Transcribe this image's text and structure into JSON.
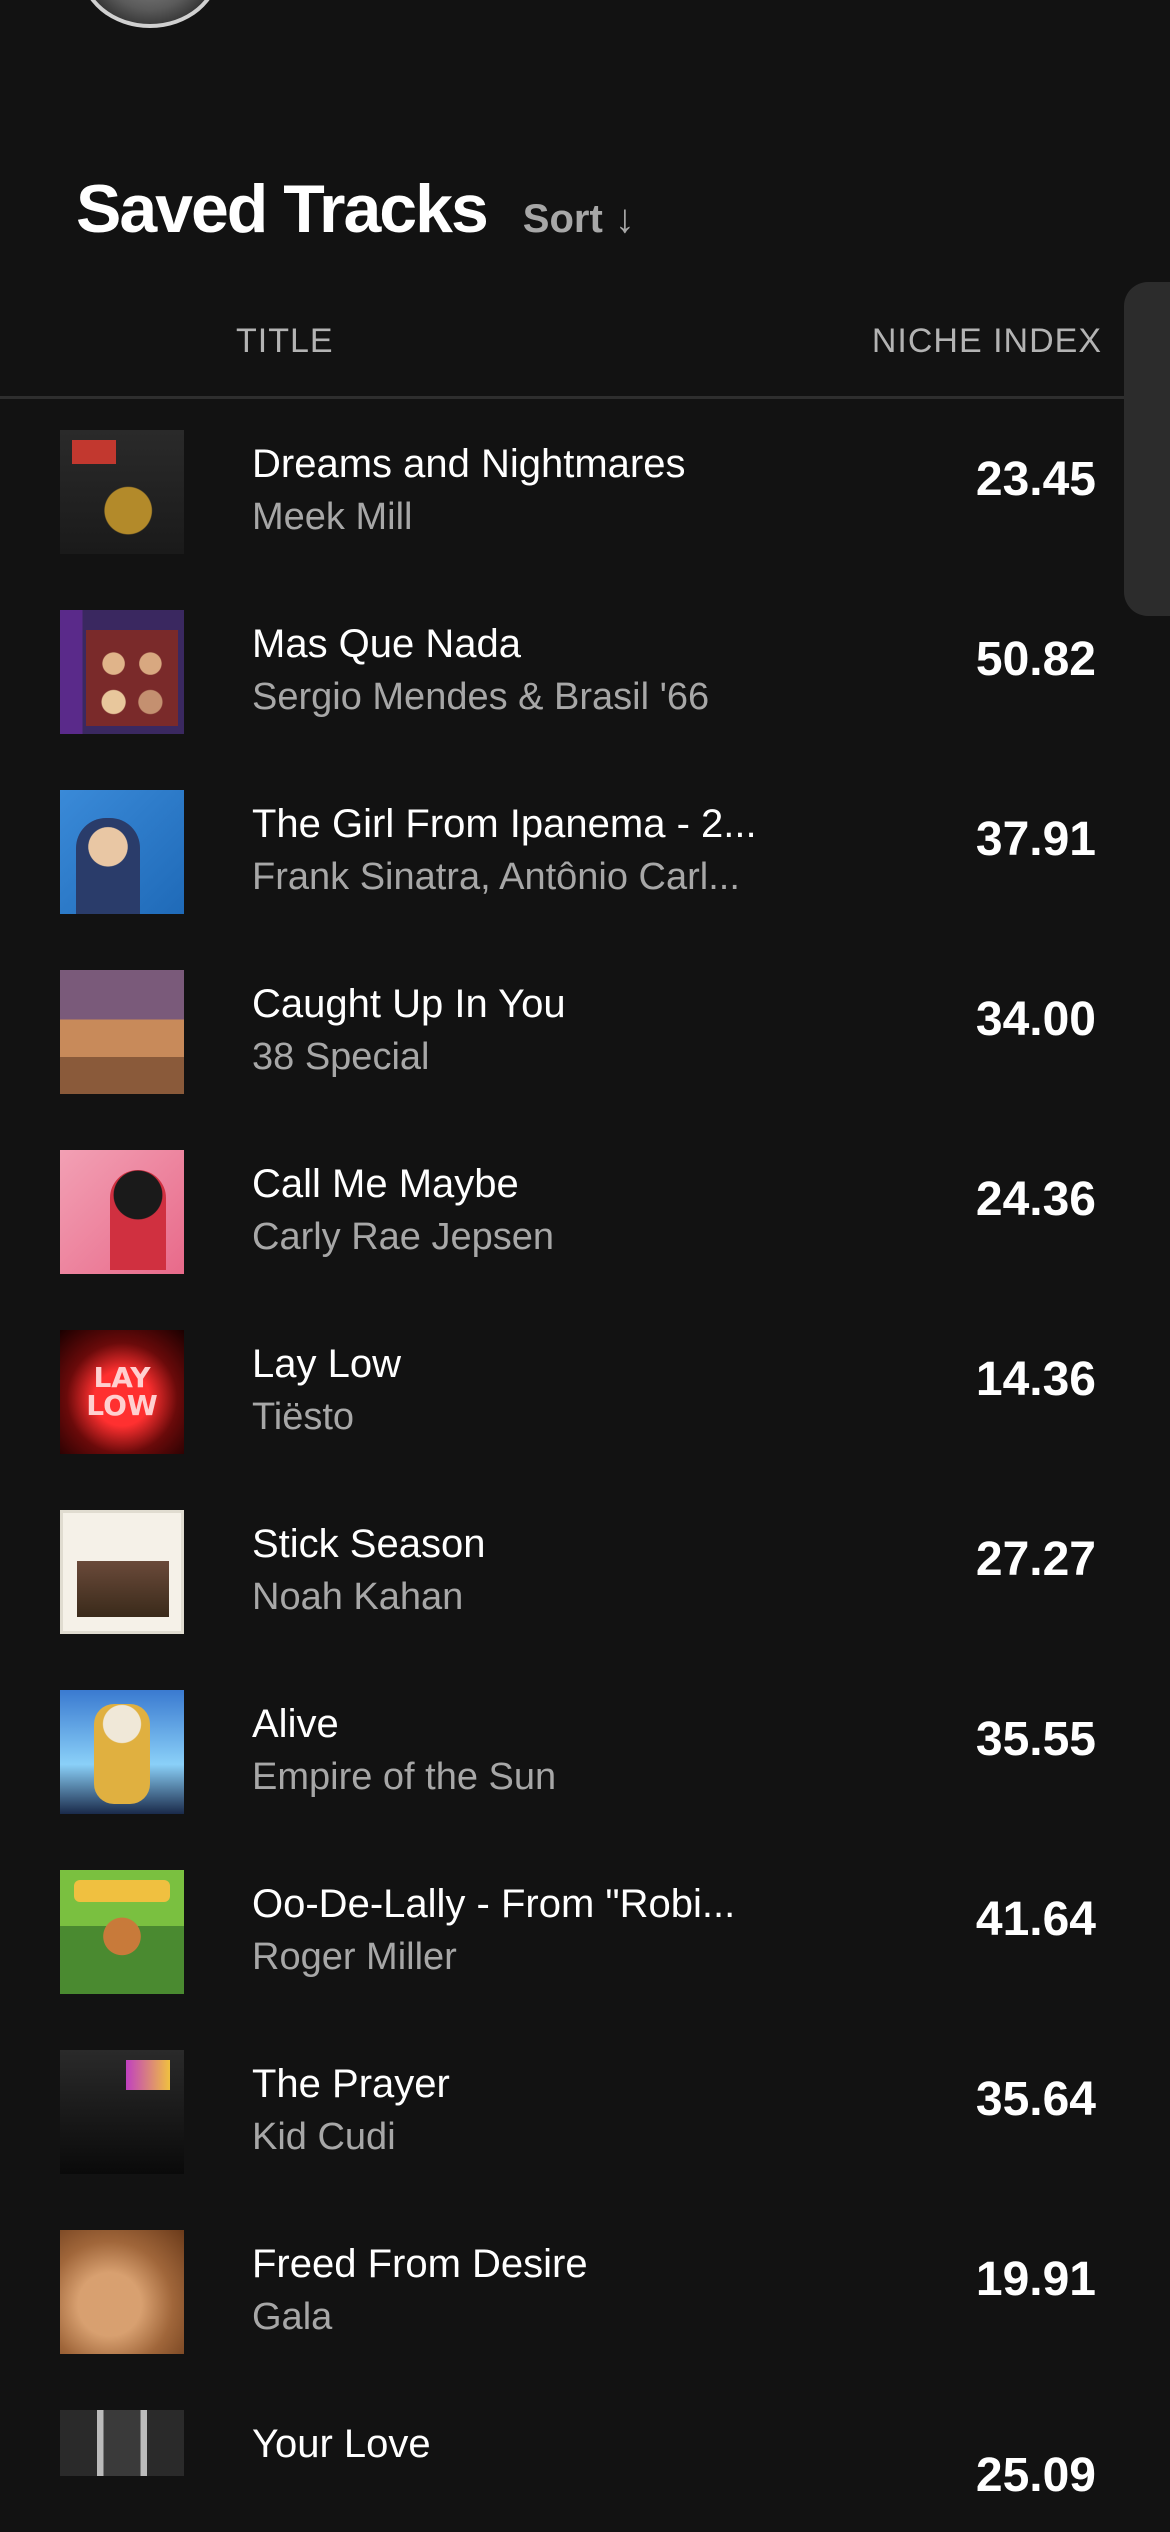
{
  "header": {
    "title": "Saved Tracks",
    "sort_label": "Sort",
    "sort_icon": "↓"
  },
  "columns": {
    "title": "TITLE",
    "niche_index": "NICHE INDEX"
  },
  "tracks": [
    {
      "title": "Dreams and Nightmares",
      "artist": "Meek Mill",
      "score": "23.45",
      "cover_icon": "album-cover"
    },
    {
      "title": "Mas Que Nada",
      "artist": "Sergio Mendes & Brasil '66",
      "score": "50.82",
      "cover_icon": "album-cover"
    },
    {
      "title": "The Girl From Ipanema - 2...",
      "artist": "Frank Sinatra, Antônio Carl...",
      "score": "37.91",
      "cover_icon": "album-cover"
    },
    {
      "title": "Caught Up In You",
      "artist": "38 Special",
      "score": "34.00",
      "cover_icon": "album-cover"
    },
    {
      "title": "Call Me Maybe",
      "artist": "Carly Rae Jepsen",
      "score": "24.36",
      "cover_icon": "album-cover"
    },
    {
      "title": "Lay Low",
      "artist": "Tiësto",
      "score": "14.36",
      "cover_icon": "album-cover"
    },
    {
      "title": "Stick Season",
      "artist": "Noah Kahan",
      "score": "27.27",
      "cover_icon": "album-cover"
    },
    {
      "title": "Alive",
      "artist": "Empire of the Sun",
      "score": "35.55",
      "cover_icon": "album-cover"
    },
    {
      "title": "Oo-De-Lally - From \"Robi...",
      "artist": "Roger Miller",
      "score": "41.64",
      "cover_icon": "album-cover"
    },
    {
      "title": "The Prayer",
      "artist": "Kid Cudi",
      "score": "35.64",
      "cover_icon": "album-cover"
    },
    {
      "title": "Freed From Desire",
      "artist": "Gala",
      "score": "19.91",
      "cover_icon": "album-cover"
    },
    {
      "title": "Your Love",
      "artist": "",
      "score": "25.09",
      "cover_icon": "album-cover"
    }
  ],
  "colors": {
    "background": "#121212",
    "primary_text": "#ffffff",
    "secondary_text": "#a7a7a7"
  }
}
